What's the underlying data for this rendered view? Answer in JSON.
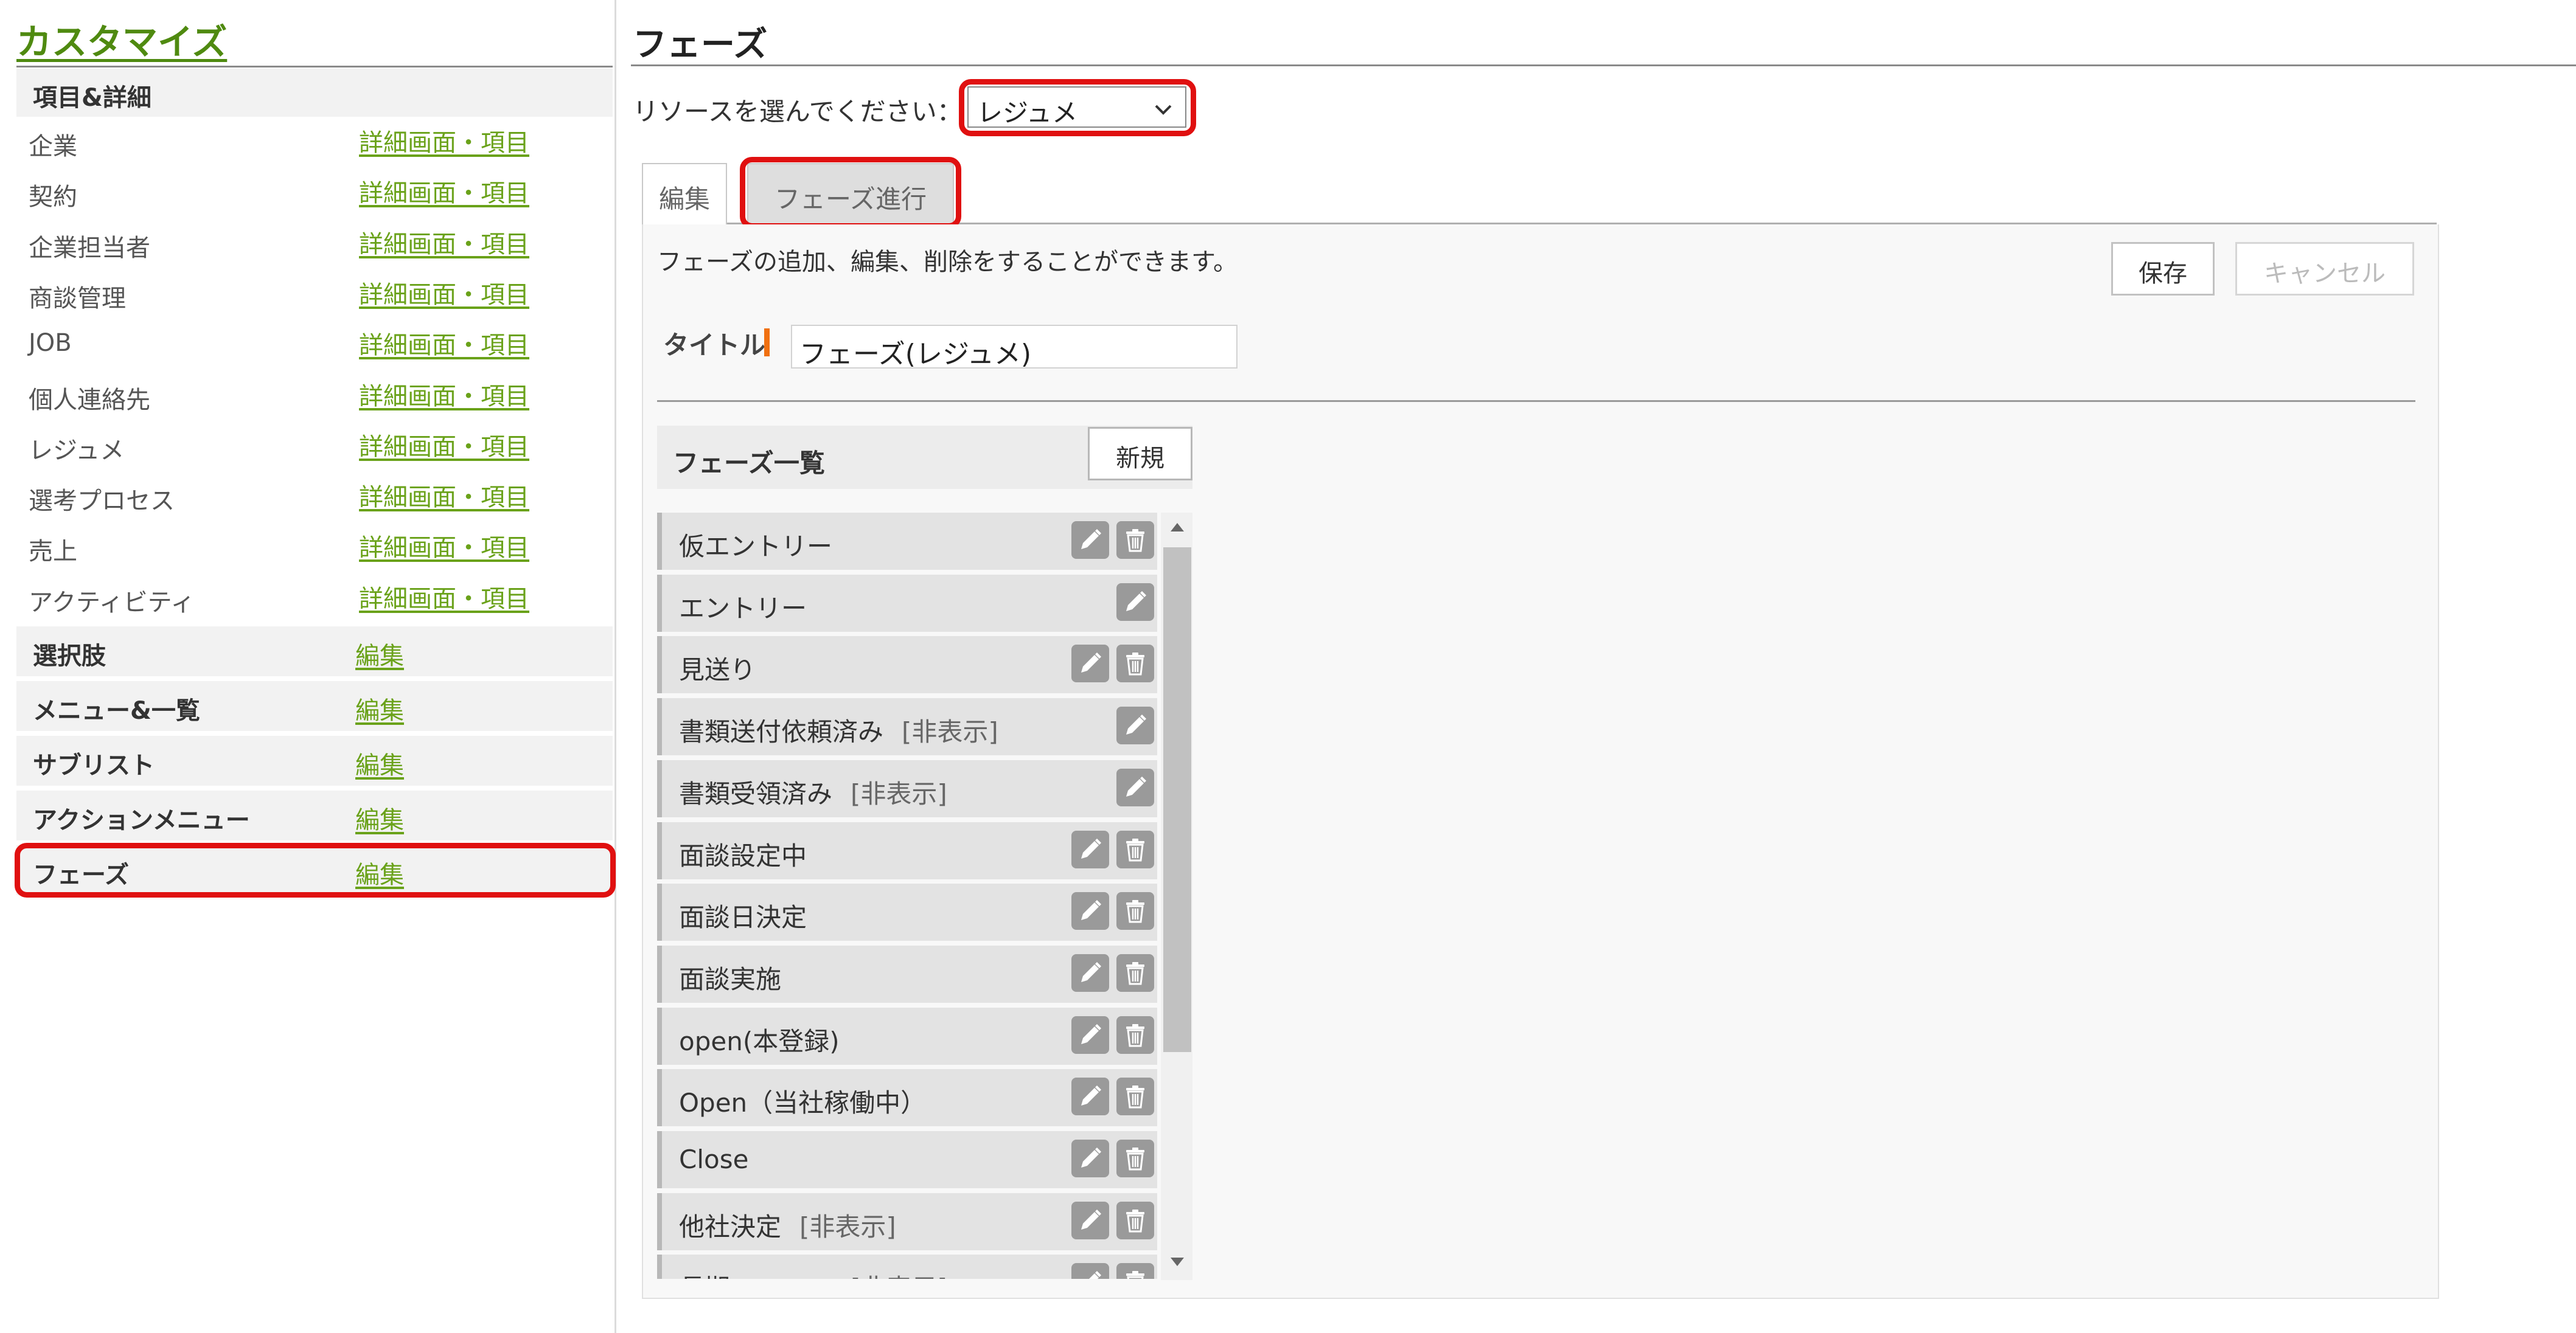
{
  "sidebar": {
    "title": "カスタマイズ",
    "section_items": {
      "label": "項目&詳細",
      "rows": [
        {
          "label": "企業",
          "link": "詳細画面・項目"
        },
        {
          "label": "契約",
          "link": "詳細画面・項目"
        },
        {
          "label": "企業担当者",
          "link": "詳細画面・項目"
        },
        {
          "label": "商談管理",
          "link": "詳細画面・項目"
        },
        {
          "label": "JOB",
          "link": "詳細画面・項目"
        },
        {
          "label": "個人連絡先",
          "link": "詳細画面・項目"
        },
        {
          "label": "レジュメ",
          "link": "詳細画面・項目"
        },
        {
          "label": "選考プロセス",
          "link": "詳細画面・項目"
        },
        {
          "label": "売上",
          "link": "詳細画面・項目"
        },
        {
          "label": "アクティビティ",
          "link": "詳細画面・項目"
        }
      ]
    },
    "sections": [
      {
        "label": "選択肢",
        "link": "編集"
      },
      {
        "label": "メニュー&一覧",
        "link": "編集"
      },
      {
        "label": "サブリスト",
        "link": "編集"
      },
      {
        "label": "アクションメニュー",
        "link": "編集"
      },
      {
        "label": "フェーズ",
        "link": "編集"
      }
    ]
  },
  "main": {
    "title": "フェーズ",
    "resource_label": "リソースを選んでください：",
    "resource_value": "レジュメ",
    "tabs": [
      {
        "label": "編集"
      },
      {
        "label": "フェーズ進行"
      }
    ],
    "description": "フェーズの追加、編集、削除をすることができます。",
    "save_label": "保存",
    "cancel_label": "キャンセル",
    "title_label": "タイトル",
    "title_value": "フェーズ(レジュメ)",
    "list_title": "フェーズ一覧",
    "new_label": "新規",
    "phases": [
      {
        "name": "仮エントリー",
        "hidden": "",
        "deletable": true
      },
      {
        "name": "エントリー",
        "hidden": "",
        "deletable": false
      },
      {
        "name": "見送り",
        "hidden": "",
        "deletable": true
      },
      {
        "name": "書類送付依頼済み",
        "hidden": "[非表示]",
        "deletable": false
      },
      {
        "name": "書類受領済み",
        "hidden": "[非表示]",
        "deletable": false
      },
      {
        "name": "面談設定中",
        "hidden": "",
        "deletable": true
      },
      {
        "name": "面談日決定",
        "hidden": "",
        "deletable": true
      },
      {
        "name": "面談実施",
        "hidden": "",
        "deletable": true
      },
      {
        "name": "open(本登録)",
        "hidden": "",
        "deletable": true
      },
      {
        "name": "Open（当社稼働中）",
        "hidden": "",
        "deletable": true
      },
      {
        "name": "Close",
        "hidden": "",
        "deletable": true
      },
      {
        "name": "他社決定",
        "hidden": "[非表示]",
        "deletable": true
      },
      {
        "name": "長期フォロー",
        "hidden": "[非表示]",
        "deletable": true
      }
    ]
  },
  "icons": {
    "edit": "pencil-icon",
    "delete": "trash-icon",
    "select": "chevron-down-icon",
    "scroll_up": "scroll-up-arrow-icon",
    "scroll_down": "scroll-down-arrow-icon"
  },
  "colors": {
    "link": "#6aa21a",
    "title": "#4f8a10",
    "highlight": "#e01010",
    "required": "#f07010"
  }
}
